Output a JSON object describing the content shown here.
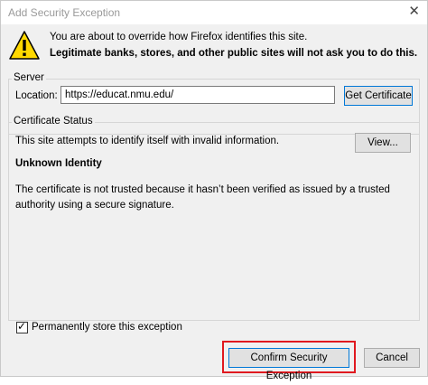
{
  "window": {
    "title": "Add Security Exception",
    "close_glyph": "✕"
  },
  "warning": {
    "icon": "warning-triangle-icon",
    "line1": "You are about to override how Firefox identifies this site.",
    "line2": "Legitimate banks, stores, and other public sites will not ask you to do this."
  },
  "server": {
    "group_label": "Server",
    "location_label": "Location:",
    "location_value": "https://educat.nmu.edu/",
    "get_certificate_label": "Get Certificate"
  },
  "certificate_status": {
    "group_label": "Certificate Status",
    "summary": "This site attempts to identify itself with invalid information.",
    "view_label": "View...",
    "heading": "Unknown Identity",
    "explanation": "The certificate is not trusted because it hasn’t been verified as issued by a trusted authority using a secure signature."
  },
  "store": {
    "checked": true,
    "label": "Permanently store this exception"
  },
  "actions": {
    "confirm_label": "Confirm Security Exception",
    "cancel_label": "Cancel"
  },
  "colors": {
    "highlight": "#e0191f",
    "warning_fill": "#ffd800"
  }
}
